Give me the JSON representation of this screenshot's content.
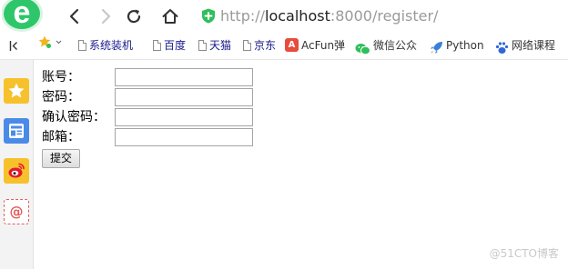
{
  "browser": {
    "url_scheme": "http://",
    "url_host": "localhost",
    "url_rest": ":8000/register/"
  },
  "bookmarks": {
    "items": [
      {
        "label": "系统装机",
        "icon": "document-icon"
      },
      {
        "label": "百度",
        "icon": "document-icon"
      },
      {
        "label": "天猫",
        "icon": "document-icon"
      },
      {
        "label": "京东",
        "icon": "document-icon"
      },
      {
        "label": "AcFun弹",
        "icon": "acfun-icon"
      },
      {
        "label": "微信公众",
        "icon": "wechat-icon"
      },
      {
        "label": "Python",
        "icon": "rocket-icon"
      },
      {
        "label": "网络课程",
        "icon": "paw-icon"
      }
    ]
  },
  "form": {
    "fields": [
      {
        "label": "账号：",
        "value": ""
      },
      {
        "label": "密码：",
        "value": ""
      },
      {
        "label": "确认密码：",
        "value": ""
      },
      {
        "label": "邮箱：",
        "value": ""
      }
    ],
    "submit_label": "提交"
  },
  "watermark": "@51CTO博客",
  "colors": {
    "logo_green": "#2ec66a",
    "secure_green": "#2fbf5b",
    "sidebar_yellow": "#f6c12b",
    "sidebar_blue": "#4a8be8"
  }
}
